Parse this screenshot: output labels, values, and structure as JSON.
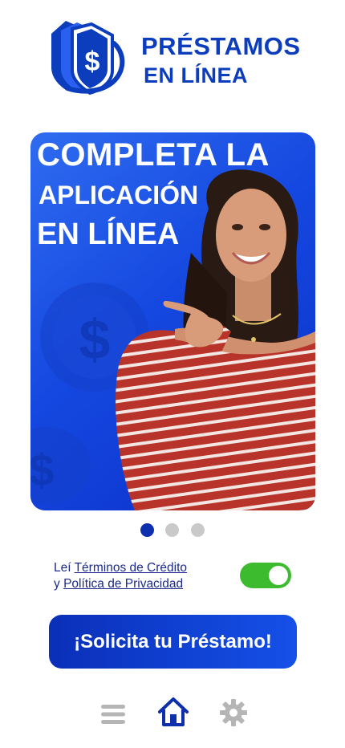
{
  "brand": {
    "line1": "PRÉSTAMOS",
    "line2": "EN LÍNEA",
    "logo_icon": "dollar-shield-icon",
    "color": "#0b3dbd"
  },
  "banner": {
    "line1": "COMPLETA LA",
    "line2": "APLICACIÓN",
    "line3": "EN LÍNEA",
    "image": "smiling-woman-pointing-photo"
  },
  "carousel": {
    "total": 3,
    "active": 1,
    "active_color": "#0d2fae",
    "inactive_color": "#c9c9c9"
  },
  "terms": {
    "prefix": "Leí",
    "link1": "Términos de Crédito",
    "connector": "y",
    "link2": "Política de Privacidad",
    "accepted": true,
    "toggle_color": "#3dbb2f"
  },
  "cta": {
    "label": "¡Solicita tu Préstamo!"
  },
  "bottom_nav": {
    "items": [
      {
        "icon": "menu-icon",
        "active": false
      },
      {
        "icon": "home-icon",
        "active": true
      },
      {
        "icon": "gear-icon",
        "active": false
      }
    ],
    "active_color": "#0d2fae",
    "inactive_color": "#b5b5b5"
  }
}
